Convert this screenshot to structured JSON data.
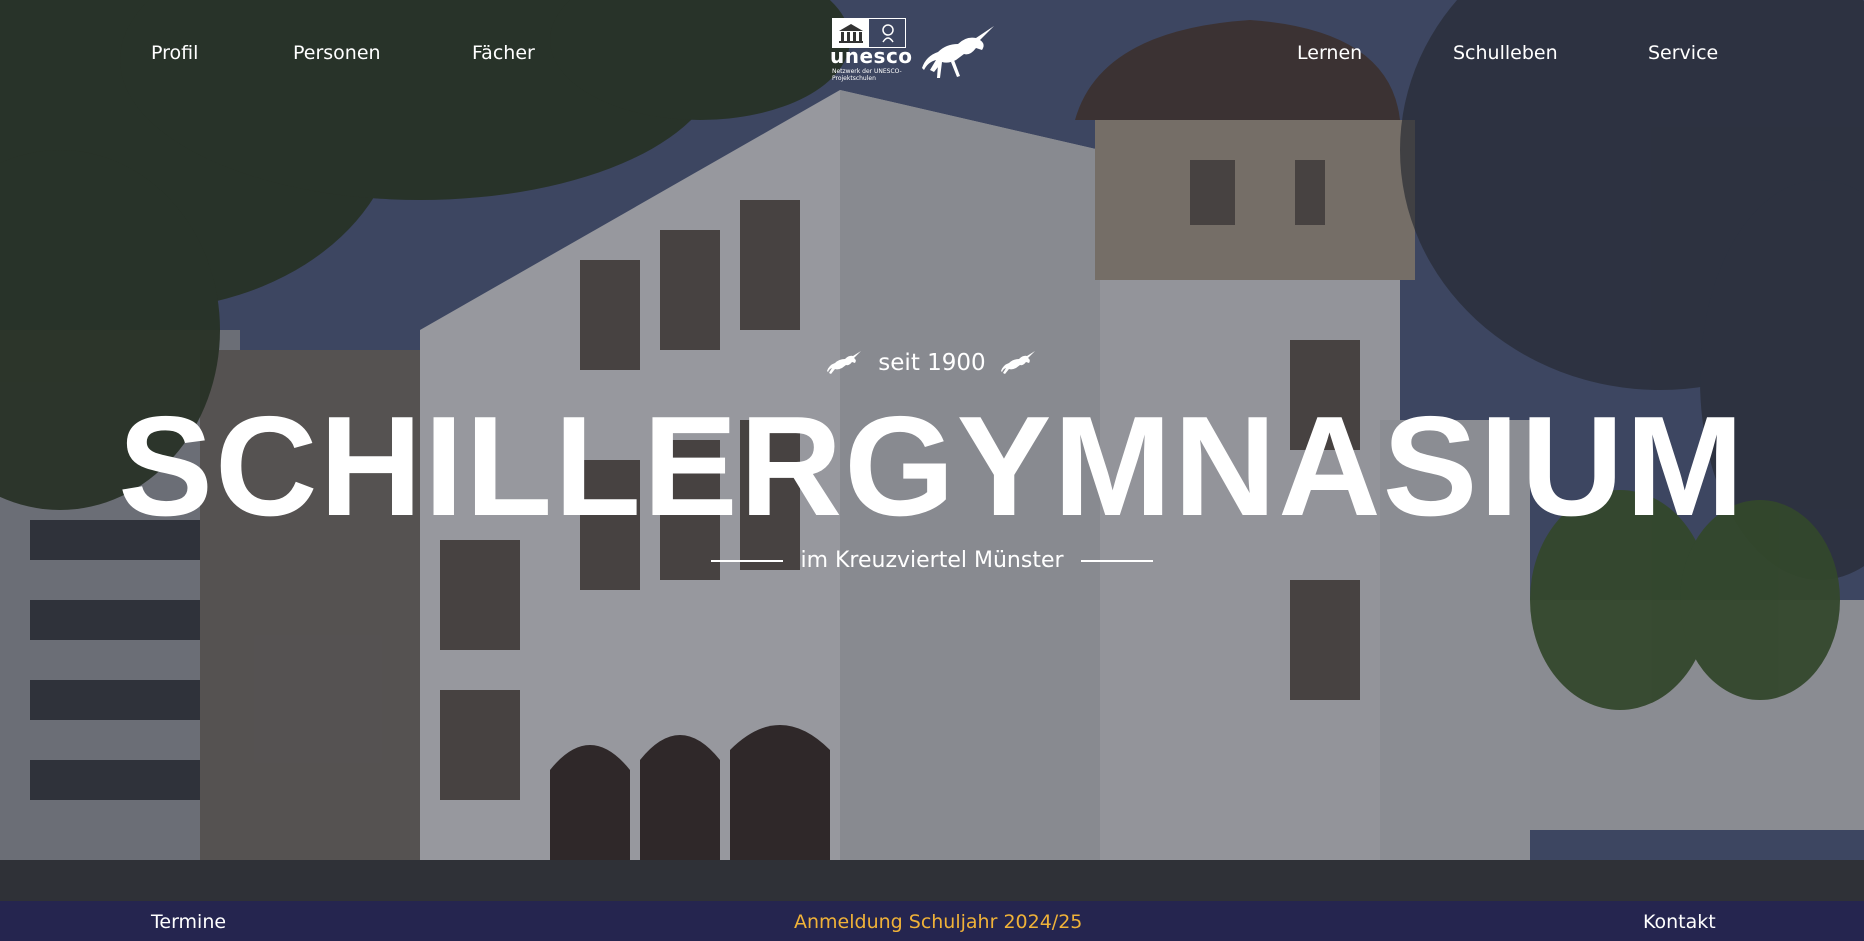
{
  "nav": {
    "left": [
      {
        "label": "Profil"
      },
      {
        "label": "Personen"
      },
      {
        "label": "Fächer"
      }
    ],
    "right": [
      {
        "label": "Lernen"
      },
      {
        "label": "Schulleben"
      },
      {
        "label": "Service"
      }
    ]
  },
  "logo": {
    "unesco_word": "unesco",
    "unesco_sub": "Netzwerk der UNESCO-Projektschulen",
    "unicorn_icon": "unicorn-icon"
  },
  "hero": {
    "since": "seit 1900",
    "title": "SCHILLERGYMNASIUM",
    "subtitle": "im Kreuzviertel Münster"
  },
  "bottom_bar": {
    "termine": "Termine",
    "anmeldung": "Anmeldung Schuljahr 2024/25",
    "kontakt": "Kontakt"
  },
  "colors": {
    "bottom_bar_bg": "#25254f",
    "highlight": "#f0b238",
    "text": "#ffffff"
  }
}
